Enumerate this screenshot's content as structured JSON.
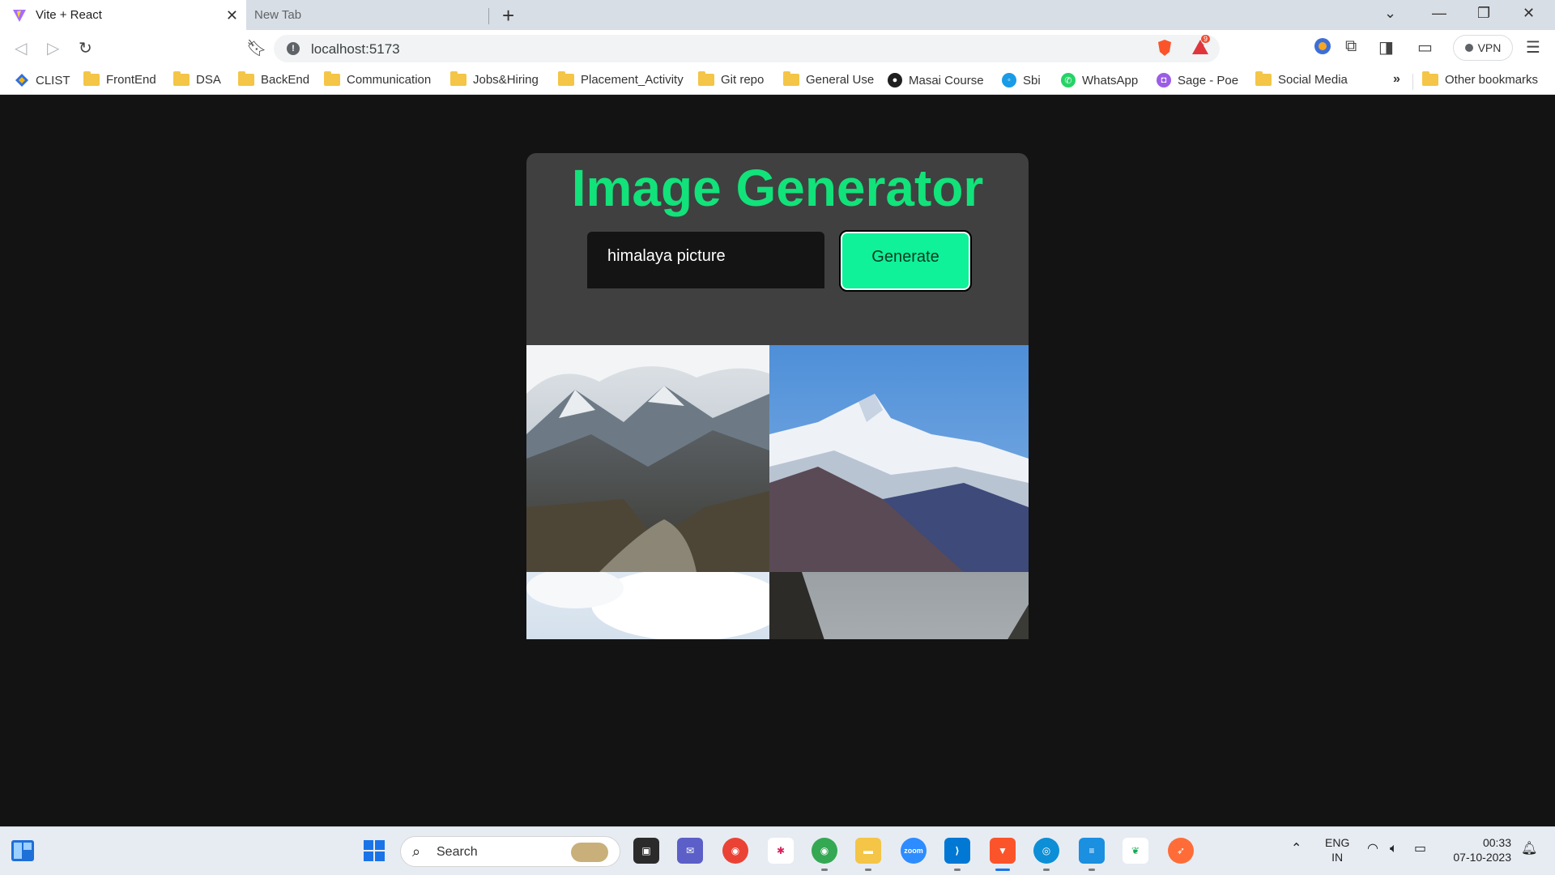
{
  "browser": {
    "tabs": [
      {
        "label": "Vite + React",
        "active": true
      },
      {
        "label": "New Tab",
        "active": false
      }
    ],
    "address": "localhost:5173",
    "vpn_label": "VPN",
    "brave_badge": "9",
    "bookmarks": [
      {
        "label": "CLIST",
        "icon": "clist-icon"
      },
      {
        "label": "FrontEnd",
        "icon": "folder-icon"
      },
      {
        "label": "DSA",
        "icon": "folder-icon"
      },
      {
        "label": "BackEnd",
        "icon": "folder-icon"
      },
      {
        "label": "Communication",
        "icon": "folder-icon"
      },
      {
        "label": "Jobs&Hiring",
        "icon": "folder-icon"
      },
      {
        "label": "Placement_Activity",
        "icon": "folder-icon"
      },
      {
        "label": "Git repo",
        "icon": "folder-icon"
      },
      {
        "label": "General Use",
        "icon": "folder-icon"
      },
      {
        "label": "Masai Course",
        "icon": "github-icon"
      },
      {
        "label": "Sbi",
        "icon": "sbi-icon"
      },
      {
        "label": "WhatsApp",
        "icon": "whatsapp-icon"
      },
      {
        "label": "Sage - Poe",
        "icon": "poe-icon"
      },
      {
        "label": "Social Media",
        "icon": "folder-icon"
      }
    ],
    "more_bookmarks": "»",
    "other_bookmarks": "Other bookmarks"
  },
  "app": {
    "title": "Image Generator",
    "prompt_value": "himalaya picture",
    "generate_label": "Generate",
    "accent": "#12e27a",
    "button_color": "#0ff29a"
  },
  "taskbar": {
    "search_label": "Search",
    "lang_top": "ENG",
    "lang_bottom": "IN",
    "time": "00:33",
    "date": "07-10-2023"
  }
}
